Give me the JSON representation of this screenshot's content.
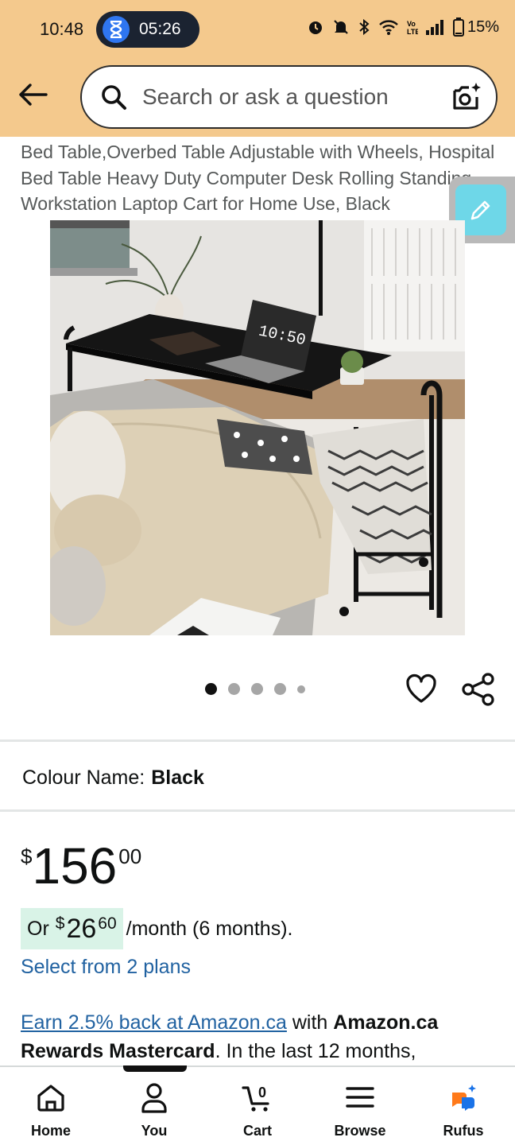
{
  "status_bar": {
    "time": "10:48",
    "timer": "05:26",
    "battery": "15%"
  },
  "search": {
    "placeholder": "Search or ask a question"
  },
  "product": {
    "title": "Bed Table,Overbed Table Adjustable with Wheels, Hospital Bed Table Heavy Duty Computer Desk Rolling Standing Workstation Laptop Cart for Home Use, Black",
    "image_laptop_screen_text": "10:50",
    "image_count": 5,
    "active_image_index": 0,
    "colour_label": "Colour Name:",
    "colour_value": "Black",
    "price": {
      "currency": "$",
      "whole": "156",
      "fraction": "00"
    },
    "installment": {
      "prefix": "Or",
      "currency": "$",
      "whole": "26",
      "fraction": "60",
      "suffix": "/month (6 months)."
    },
    "plans_link": "Select from 2 plans",
    "rewards": {
      "link": "Earn 2.5% back at Amazon.ca",
      "text1": " with ",
      "bold1": "Amazon.ca Rewards Mastercard",
      "text2": ". In the last 12 months,"
    }
  },
  "bottom_nav": {
    "items": [
      {
        "label": "Home",
        "icon": "home-icon"
      },
      {
        "label": "You",
        "icon": "person-icon"
      },
      {
        "label": "Cart",
        "icon": "cart-icon",
        "badge": "0"
      },
      {
        "label": "Browse",
        "icon": "menu-icon"
      },
      {
        "label": "Rufus",
        "icon": "rufus-icon"
      }
    ]
  },
  "colors": {
    "header_bg": "#f4c98d",
    "link": "#2162a1",
    "installment_bg": "#d9f3e7",
    "edit_fab": "#6ed7e8"
  }
}
